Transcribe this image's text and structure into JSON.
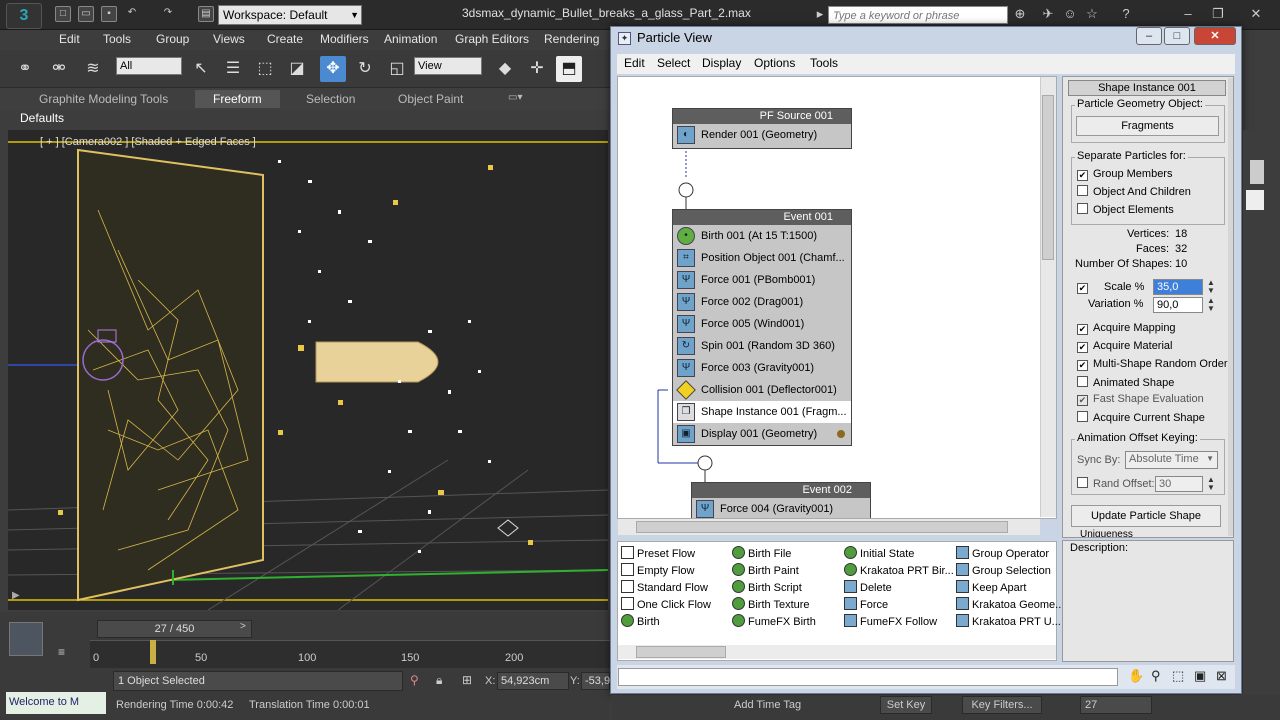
{
  "app": {
    "logo": "3",
    "workspace": "Workspace: Default",
    "title": "3dsmax_dynamic_Bullet_breaks_a_glass_Part_2.max",
    "search_placeholder": "Type a keyword or phrase"
  },
  "menu": [
    "Edit",
    "Tools",
    "Group",
    "Views",
    "Create",
    "Modifiers",
    "Animation",
    "Graph Editors",
    "Rendering"
  ],
  "toolbar": {
    "filter": "All",
    "ref_coord": "View"
  },
  "ribbon": {
    "tabs": [
      "Graphite Modeling Tools",
      "Freeform",
      "Selection",
      "Object Paint"
    ],
    "defaults": "Defaults"
  },
  "viewport": {
    "label": "[ + ] [Camera002 ] [Shaded + Edged Faces ]"
  },
  "timeline": {
    "frame": "27 / 450",
    "ruler": [
      "0",
      "50",
      "100",
      "150",
      "200"
    ],
    "status": "1 Object Selected",
    "x_label": "X:",
    "x_value": "54,923cm",
    "y_label": "Y:",
    "y_value": "-53,9",
    "welcome": "Welcome to M",
    "rendering_time": "Rendering Time 0:00:42",
    "translation_time": "Translation Time 0:00:01",
    "add_time_tag": "Add Time Tag",
    "set_key": "Set Key",
    "key_filters": "Key Filters...",
    "frame_field": "27"
  },
  "particle_view": {
    "title": "Particle View",
    "menu": [
      "Edit",
      "Select",
      "Display",
      "Options",
      "Tools"
    ],
    "pf_source": {
      "name": "PF Source 001",
      "rows": [
        "Render 001 (Geometry)"
      ]
    },
    "event1": {
      "name": "Event 001",
      "rows": [
        "Birth 001 (At 15 T:1500)",
        "Position Object 001 (Chamf...",
        "Force 001 (PBomb001)",
        "Force 002 (Drag001)",
        "Force 005 (Wind001)",
        "Spin 001 (Random 3D 360)",
        "Force 003 (Gravity001)",
        "Collision 001 (Deflector001)",
        "Shape Instance 001 (Fragm...",
        "Display 001 (Geometry)"
      ]
    },
    "event2": {
      "name": "Event 002",
      "rows": [
        "Force 004 (Gravity001)"
      ]
    },
    "depot": [
      [
        "Preset Flow",
        "Empty Flow",
        "Standard Flow",
        "One Click Flow",
        "Birth"
      ],
      [
        "Birth File",
        "Birth Paint",
        "Birth Script",
        "Birth Texture",
        "FumeFX Birth"
      ],
      [
        "Initial State",
        "Krakatoa PRT Bir...",
        "Delete",
        "Force",
        "FumeFX Follow"
      ],
      [
        "Group Operator",
        "Group Selection",
        "Keep Apart",
        "Krakatoa Geome...",
        "Krakatoa PRT U..."
      ]
    ],
    "panel": {
      "header": "Shape Instance 001",
      "geom_group": "Particle Geometry Object:",
      "geom_button": "Fragments",
      "separate_group": "Separate Particles for:",
      "separate_opts": [
        "Group Members",
        "Object And Children",
        "Object Elements"
      ],
      "vertices_label": "Vertices:",
      "vertices": "18",
      "faces_label": "Faces:",
      "faces": "32",
      "shapes_label": "Number Of Shapes:",
      "shapes": "10",
      "scale_label": "Scale %",
      "scale": "35,0",
      "variation_label": "Variation %",
      "variation": "90,0",
      "options": [
        "Acquire Mapping",
        "Acquire Material",
        "Multi-Shape Random Order",
        "Animated Shape",
        "Fast Shape Evaluation",
        "Acquire Current Shape"
      ],
      "anim_group": "Animation Offset Keying:",
      "sync_label": "Sync By:",
      "sync": "Absolute Time",
      "rand_label": "Rand Offset:",
      "rand": "30",
      "update_button": "Update Particle Shape",
      "uniqueness": "Uniqueness",
      "description": "Description:"
    }
  }
}
